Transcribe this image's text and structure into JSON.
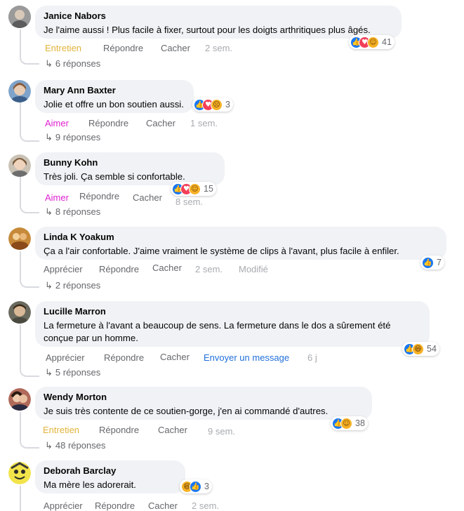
{
  "comments": [
    {
      "author": "Janice Nabors",
      "text": "Je l'aime aussi ! Plus facile à fixer, surtout pour les doigts arthritiques plus âgés.",
      "reaction_count": "41",
      "actions": {
        "a": "Entretien",
        "b": "Répondre",
        "c": "Cacher",
        "time": "2 sem."
      },
      "a_color": "#e2b33a",
      "replies": "6 réponses"
    },
    {
      "author": "Mary Ann Baxter",
      "text": "Jolie et offre un bon soutien aussi.",
      "reaction_count": "3",
      "actions": {
        "a": "Aimer",
        "b": "Répondre",
        "c": "Cacher",
        "time": "1 sem."
      },
      "a_color": "#e020d0",
      "replies": "9 réponses"
    },
    {
      "author": "Bunny Kohn",
      "text": "Très joli. Ça semble si confortable.",
      "reaction_count": "15",
      "actions": {
        "a": "Aimer",
        "b": "Répondre",
        "c": "Cacher",
        "time": "8 sem."
      },
      "a_color": "#e020d0",
      "replies": "8 réponses"
    },
    {
      "author": "Linda K Yoakum",
      "text": "Ça a l'air confortable. J'aime vraiment le système de clips à l'avant, plus facile à enfiler.",
      "reaction_count": "7",
      "actions": {
        "a": "Apprécier",
        "b": "Répondre",
        "c": "Cacher",
        "time": "2 sem.",
        "extra": "Modifié"
      },
      "a_color": "#65676b",
      "replies": "2 réponses"
    },
    {
      "author": "Lucille Marron",
      "text": "La fermeture à l'avant a beaucoup de sens. La fermeture dans le dos a sûrement été conçue par un homme.",
      "reaction_count": "54",
      "actions": {
        "a": "Apprécier",
        "b": "Répondre",
        "c": "Cacher",
        "message": "Envoyer un message",
        "time": "6 j"
      },
      "a_color": "#65676b",
      "message_color": "#216fdb",
      "replies": "5 réponses"
    },
    {
      "author": "Wendy Morton",
      "text": "Je suis très contente de ce soutien-gorge, j'en ai commandé d'autres.",
      "reaction_count": "38",
      "actions": {
        "a": "Entretien",
        "b": "Répondre",
        "c": "Cacher",
        "time": "9 sem."
      },
      "a_color": "#e2b33a",
      "replies": "48 réponses"
    },
    {
      "author": "Deborah Barclay",
      "text": "Ma mère les adorerait.",
      "reaction_count": "3",
      "actions": {
        "a": "Apprécier",
        "b": "Répondre",
        "c": "Cacher",
        "time": "2 sem."
      },
      "a_color": "#65676b"
    }
  ],
  "icons": {
    "like": "like-reaction-icon",
    "love": "love-reaction-icon",
    "care": "care-reaction-icon",
    "haha": "haha-reaction-icon",
    "sad": "sad-reaction-icon",
    "reply": "reply-arrow-icon"
  },
  "colors": {
    "bubble": "#f0f2f5",
    "muted": "#65676b",
    "like": "#1877f2",
    "love": "#f33e58",
    "emoji": "#f7b125"
  }
}
